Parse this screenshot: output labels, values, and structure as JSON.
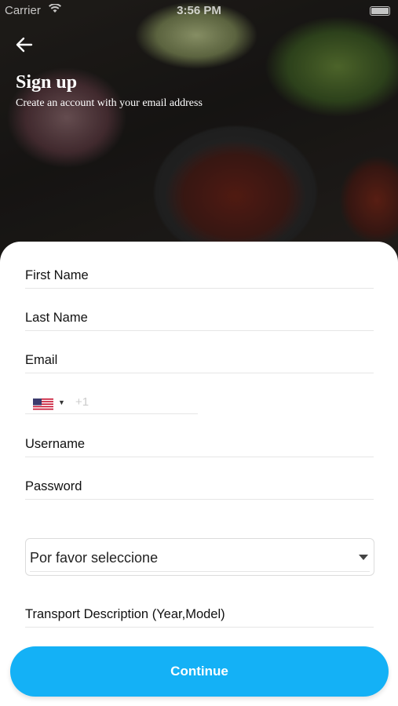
{
  "status_bar": {
    "carrier": "Carrier",
    "time": "3:56 PM"
  },
  "header": {
    "title": "Sign up",
    "subtitle": "Create an account with your email address"
  },
  "form": {
    "first_name": "First Name",
    "last_name": "Last Name",
    "email": "Email",
    "phone_code": "+1",
    "phone_country": "US",
    "username": "Username",
    "password": "Password",
    "select_value": "Por favor seleccione",
    "transport": "Transport Description (Year,Model)"
  },
  "continue_label": "Continue",
  "colors": {
    "accent": "#14b1f6",
    "flag_red": "#c8102e",
    "flag_blue": "#3c3b6e"
  },
  "icons": {
    "back": "arrow-left-icon",
    "wifi": "wifi-icon",
    "battery": "battery-icon",
    "dropdown": "chevron-down-icon"
  }
}
